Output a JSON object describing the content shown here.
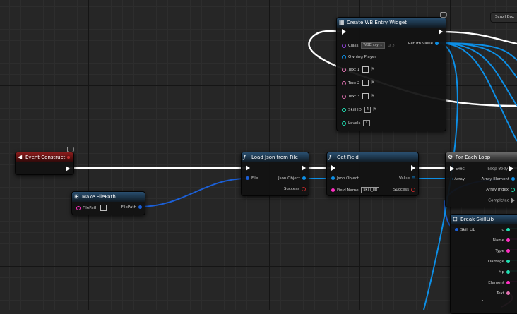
{
  "nodes": {
    "create_widget": {
      "title": "Create WB Entry Widget",
      "class_label": "Class",
      "class_value": "WBEntry",
      "owning_player": "Owning Player",
      "text1": "Text 1",
      "text2": "Text 2",
      "text3": "Text 3",
      "skill_id": "Skill ID",
      "skill_id_value": "4",
      "levels": "Levels",
      "levels_value": "1",
      "return_value": "Return Value"
    },
    "event_construct": {
      "title": "Event Construct"
    },
    "make_filepath": {
      "title": "Make FilePath",
      "in_label": "FilePath",
      "out_label": "FilePath"
    },
    "load_json": {
      "title": "Load Json from File",
      "file": "File",
      "json_object": "Json Object",
      "success": "Success"
    },
    "get_field": {
      "title": "Get Field",
      "json_object": "Json Object",
      "field_name": "Field Name",
      "field_value": "skill_lib",
      "value": "Value",
      "success": "Success"
    },
    "for_each": {
      "title": "For Each Loop",
      "exec": "Exec",
      "array": "Array",
      "loop_body": "Loop Body",
      "array_element": "Array Element",
      "array_index": "Array Index",
      "completed": "Completed"
    },
    "break_struct": {
      "title": "Break SkillLib",
      "skill_lib": "Skill Lib",
      "id": "Id",
      "name": "Name",
      "type": "Type",
      "damage": "Damage",
      "mp": "Mp",
      "element": "Element",
      "text": "Text"
    }
  },
  "scroll_box": "Scroll Box",
  "colors": {
    "exec": "#ffffff",
    "object": "#0d8fe6",
    "string": "#ff2ec2",
    "int": "#1fe0b3",
    "bool": "#8c0d0d",
    "struct": "#0d4fa8",
    "text": "#e070b0"
  }
}
